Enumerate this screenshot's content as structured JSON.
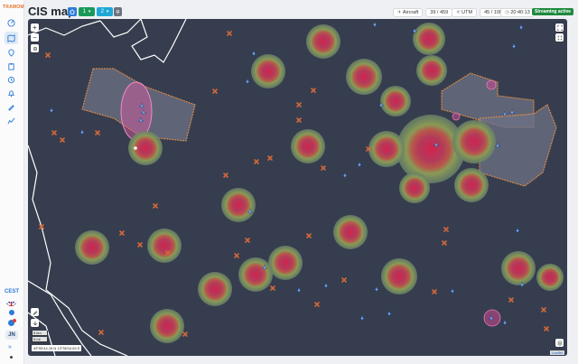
{
  "app": {
    "logo_text": "TRAMOM",
    "title": "CIS map"
  },
  "header": {
    "buttons": [
      {
        "icon": "home-icon",
        "color": "#2b7bd8"
      },
      {
        "label": "1",
        "color": "#1a9a5a",
        "icon": "chevron-down-icon"
      },
      {
        "label": "2",
        "color": "#1fa7d6",
        "icon": "chevron-down-icon"
      },
      {
        "icon": "pin-icon",
        "color": "#6b7280"
      }
    ],
    "aircraft_label": "Aircraft",
    "aircraft_count": "39",
    "aircraft_total": "459",
    "utm_label": "UTM",
    "utm_count": "45",
    "utm_total": "100",
    "clock": "20:40:13",
    "status": "Streaming active",
    "status_color": "#1e8a3c"
  },
  "sidebar": {
    "items": [
      "radar-icon",
      "map-icon",
      "pin-icon",
      "clipboard-icon",
      "history-icon",
      "bell-icon",
      "paint-icon",
      "chart-icon"
    ],
    "active_index": 1,
    "timezone": "CEST",
    "avatar": "JN"
  },
  "map": {
    "background": "#363d4e",
    "scale_lines": [
      "5 km",
      "5 mi"
    ],
    "coordinates": "49°55'44.15 N 13°36'04.63 E",
    "attribution": "Leaflet"
  }
}
